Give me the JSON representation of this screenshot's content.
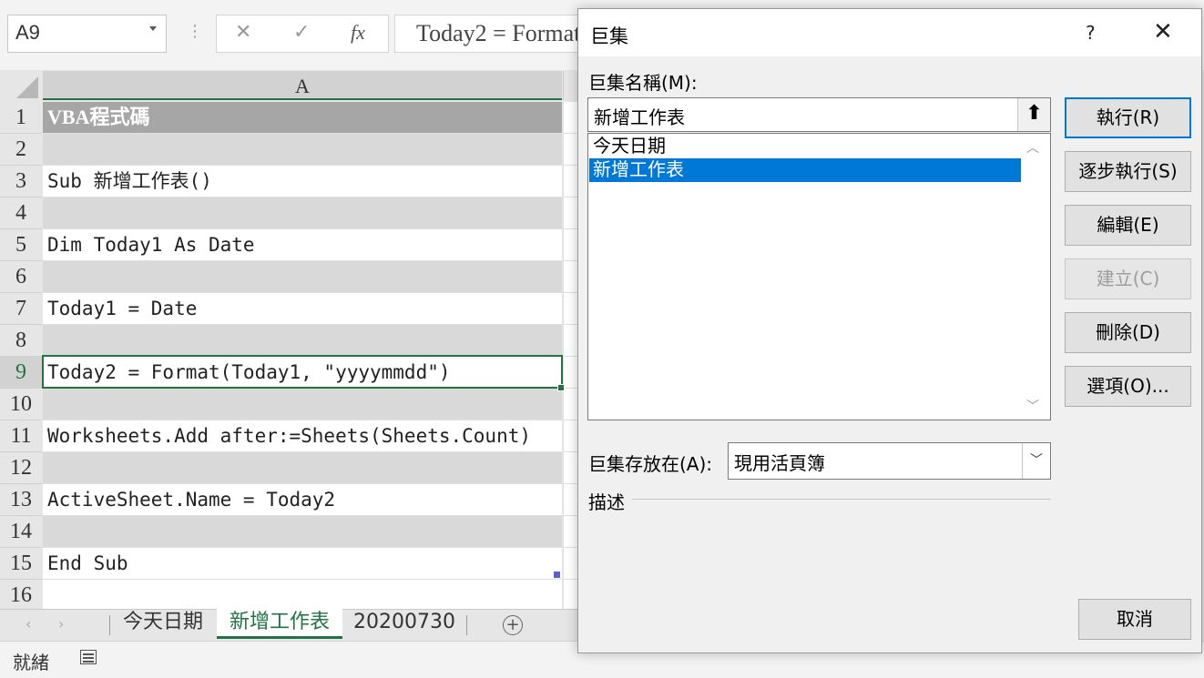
{
  "formula_bar": {
    "name_box": "A9",
    "cancel_icon": "✕",
    "enter_icon": "✓",
    "fx_icon": "fx",
    "formula": "Today2 = Format(Today1, \"yyyymmdd\")"
  },
  "sheet": {
    "column_header": "A",
    "rows": [
      {
        "num": "1",
        "text": "VBA程式碼"
      },
      {
        "num": "2",
        "text": ""
      },
      {
        "num": "3",
        "text": "Sub 新增工作表()"
      },
      {
        "num": "4",
        "text": ""
      },
      {
        "num": "5",
        "text": "Dim Today1 As Date"
      },
      {
        "num": "6",
        "text": ""
      },
      {
        "num": "7",
        "text": "Today1 = Date"
      },
      {
        "num": "8",
        "text": ""
      },
      {
        "num": "9",
        "text": "Today2 = Format(Today1, \"yyyymmdd\")"
      },
      {
        "num": "10",
        "text": ""
      },
      {
        "num": "11",
        "text": "Worksheets.Add after:=Sheets(Sheets.Count)"
      },
      {
        "num": "12",
        "text": ""
      },
      {
        "num": "13",
        "text": "ActiveSheet.Name = Today2"
      },
      {
        "num": "14",
        "text": ""
      },
      {
        "num": "15",
        "text": "End Sub"
      },
      {
        "num": "16",
        "text": ""
      }
    ]
  },
  "tabs": [
    {
      "label": "今天日期"
    },
    {
      "label": "新增工作表"
    },
    {
      "label": "20200730"
    }
  ],
  "status": {
    "text": "就緒"
  },
  "dialog": {
    "title": "巨集",
    "help": "?",
    "close": "✕",
    "name_label": "巨集名稱(M):",
    "name_value": "新增工作表",
    "macros": [
      "今天日期",
      "新增工作表"
    ],
    "buttons": {
      "run": "執行(R)",
      "step": "逐步執行(S)",
      "edit": "編輯(E)",
      "create": "建立(C)",
      "delete": "刪除(D)",
      "options": "選項(O)..."
    },
    "store_label": "巨集存放在(A):",
    "store_value": "現用活頁簿",
    "desc_label": "描述",
    "cancel": "取消"
  },
  "colors": {
    "accent": "#217346",
    "selection": "#0078d7"
  }
}
